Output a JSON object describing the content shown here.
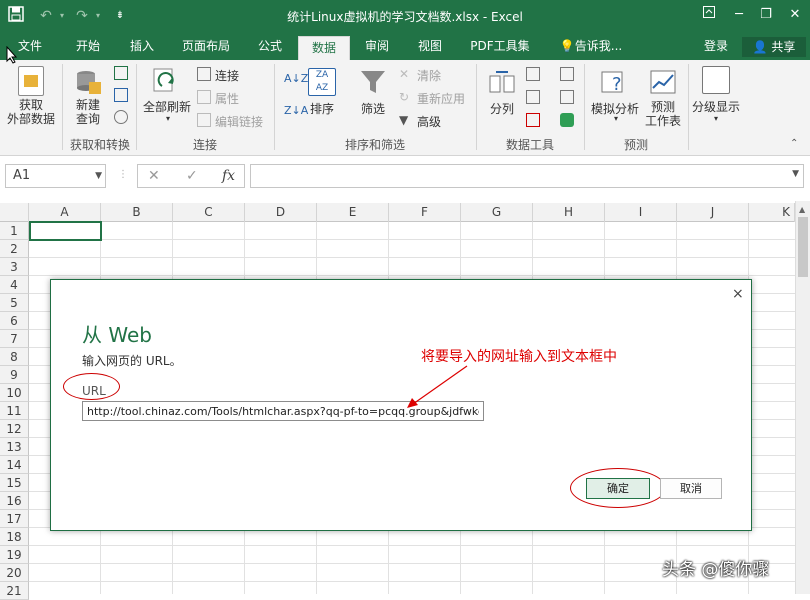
{
  "window": {
    "title": "统计Linux虚拟机的学习文档数.xlsx - Excel",
    "accent_color": "#217346",
    "qat_icons": [
      "save-icon",
      "undo-icon",
      "redo-icon",
      "customize-icon"
    ],
    "controls": [
      "ribbon-options-icon",
      "minimize-icon",
      "restore-icon",
      "close-icon"
    ]
  },
  "tabs": [
    "文件",
    "开始",
    "插入",
    "页面布局",
    "公式",
    "数据",
    "审阅",
    "视图",
    "PDF工具集"
  ],
  "active_tab": "数据",
  "tell_me": "告诉我...",
  "login": "登录",
  "share": "共享",
  "ribbon": {
    "get_external": "获取\n外部数据",
    "new_query": "新建\n查询",
    "group_get_transform": "获取和转换",
    "refresh_all": "全部刷新",
    "connections": "连接",
    "properties": "属性",
    "edit_links": "编辑链接",
    "group_connections": "连接",
    "sort": "排序",
    "filter": "筛选",
    "clear": "清除",
    "reapply": "重新应用",
    "advanced": "高级",
    "group_sort_filter": "排序和筛选",
    "text_to_columns": "分列",
    "group_data_tools": "数据工具",
    "what_if": "模拟分析",
    "forecast_sheet": "预测\n工作表",
    "group_forecast": "预测",
    "outline": "分级显示"
  },
  "formula_bar": {
    "name_box": "A1",
    "cancel": "✕",
    "enter": "✓",
    "fx": "fx",
    "value": ""
  },
  "grid": {
    "columns": [
      "A",
      "B",
      "C",
      "D",
      "E",
      "F",
      "G",
      "H",
      "I",
      "J",
      "K"
    ],
    "rows": [
      "1",
      "2",
      "3",
      "4",
      "5",
      "6",
      "7",
      "8",
      "9",
      "10",
      "11",
      "12",
      "13",
      "14",
      "15",
      "16",
      "17",
      "18",
      "19",
      "20",
      "21"
    ]
  },
  "dialog": {
    "title": "从 Web",
    "description": "输入网页的 URL。",
    "url_label": "URL",
    "url_value": "http://tool.chinaz.com/Tools/htmlchar.aspx?qq-pf-to=pcqq.group&jdfwkey",
    "ok": "确定",
    "cancel": "取消",
    "close": "×"
  },
  "annotation": {
    "text": "将要导入的网址输入到文本框中",
    "color": "#dd0000"
  },
  "watermark": "头条 @傻你骤"
}
